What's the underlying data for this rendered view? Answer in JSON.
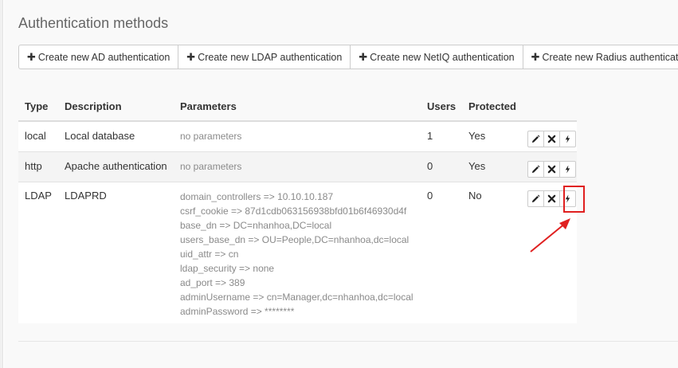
{
  "page": {
    "title": "Authentication methods"
  },
  "toolbar": {
    "buttons": [
      {
        "label": "Create new AD authentication"
      },
      {
        "label": "Create new LDAP authentication"
      },
      {
        "label": "Create new NetIQ authentication"
      },
      {
        "label": "Create new Radius authentication"
      }
    ]
  },
  "table": {
    "headers": [
      "Type",
      "Description",
      "Parameters",
      "Users",
      "Protected"
    ],
    "rows": [
      {
        "type": "local",
        "description": "Local database",
        "parameters": [
          "no parameters"
        ],
        "users": "1",
        "protected": "Yes",
        "actions": [
          "edit-icon",
          "delete-icon",
          "bolt-icon"
        ]
      },
      {
        "type": "http",
        "description": "Apache authentication",
        "parameters": [
          "no parameters"
        ],
        "users": "0",
        "protected": "Yes",
        "actions": [
          "edit-icon",
          "delete-icon",
          "bolt-icon"
        ]
      },
      {
        "type": "LDAP",
        "description": "LDAPRD",
        "parameters": [
          "domain_controllers => 10.10.10.187",
          "csrf_cookie => 87d1cdb063156938bfd01b6f46930d4f",
          "base_dn => DC=nhanhoa,DC=local",
          "users_base_dn => OU=People,DC=nhanhoa,dc=local",
          "uid_attr => cn",
          "ldap_security => none",
          "ad_port => 389",
          "adminUsername => cn=Manager,dc=nhanhoa,dc=local",
          "adminPassword => ********"
        ],
        "users": "0",
        "protected": "No",
        "actions": [
          "edit-icon",
          "delete-icon",
          "bolt-icon"
        ]
      }
    ]
  },
  "annotation": {
    "color": "#e02020"
  }
}
